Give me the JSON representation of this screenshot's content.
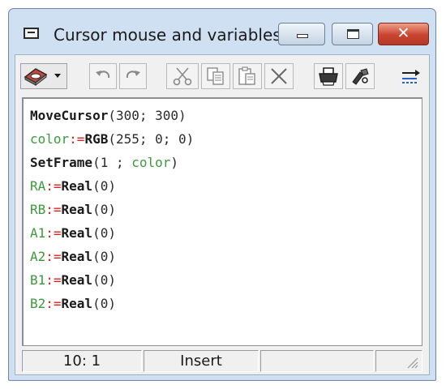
{
  "window": {
    "title": "Cursor mouse and variables",
    "close_glyph": "✕"
  },
  "icons": {
    "system_menu": "window-icon",
    "toolbar": [
      "drive-icon",
      "dropdown-arrow-icon",
      "undo-icon",
      "redo-icon",
      "cut-icon",
      "copy-icon",
      "paste-icon",
      "delete-icon",
      "print-icon",
      "tools-icon",
      "settings-icon"
    ]
  },
  "code_lines": [
    [
      {
        "t": "MoveCursor",
        "c": "kw"
      },
      {
        "t": "(300; 300)",
        "c": "num"
      }
    ],
    [
      {
        "t": "color",
        "c": "var"
      },
      {
        "t": ":=",
        "c": "op"
      },
      {
        "t": "RGB",
        "c": "kw"
      },
      {
        "t": "(255; 0; 0)",
        "c": "num"
      }
    ],
    [
      {
        "t": "SetFrame",
        "c": "kw"
      },
      {
        "t": "(1 ; ",
        "c": "num"
      },
      {
        "t": "color",
        "c": "var"
      },
      {
        "t": ")",
        "c": "num"
      }
    ],
    [
      {
        "t": "RA",
        "c": "var"
      },
      {
        "t": ":=",
        "c": "op"
      },
      {
        "t": "Real",
        "c": "kw"
      },
      {
        "t": "(0)",
        "c": "num"
      }
    ],
    [
      {
        "t": "RB",
        "c": "var"
      },
      {
        "t": ":=",
        "c": "op"
      },
      {
        "t": "Real",
        "c": "kw"
      },
      {
        "t": "(0)",
        "c": "num"
      }
    ],
    [
      {
        "t": "A1",
        "c": "var"
      },
      {
        "t": ":=",
        "c": "op"
      },
      {
        "t": "Real",
        "c": "kw"
      },
      {
        "t": "(0)",
        "c": "num"
      }
    ],
    [
      {
        "t": "A2",
        "c": "var"
      },
      {
        "t": ":=",
        "c": "op"
      },
      {
        "t": "Real",
        "c": "kw"
      },
      {
        "t": "(0)",
        "c": "num"
      }
    ],
    [
      {
        "t": "B1",
        "c": "var"
      },
      {
        "t": ":=",
        "c": "op"
      },
      {
        "t": "Real",
        "c": "kw"
      },
      {
        "t": "(0)",
        "c": "num"
      }
    ],
    [
      {
        "t": "B2",
        "c": "var"
      },
      {
        "t": ":=",
        "c": "op"
      },
      {
        "t": "Real",
        "c": "kw"
      },
      {
        "t": "(0)",
        "c": "num"
      }
    ]
  ],
  "status": {
    "position": "10: 1",
    "mode": "Insert",
    "cell3": "",
    "cell4": ""
  },
  "colors": {
    "keyword": "#1a1a1a",
    "variable": "#3c9a3c",
    "operator": "#e0201a",
    "close": "#c94430"
  }
}
